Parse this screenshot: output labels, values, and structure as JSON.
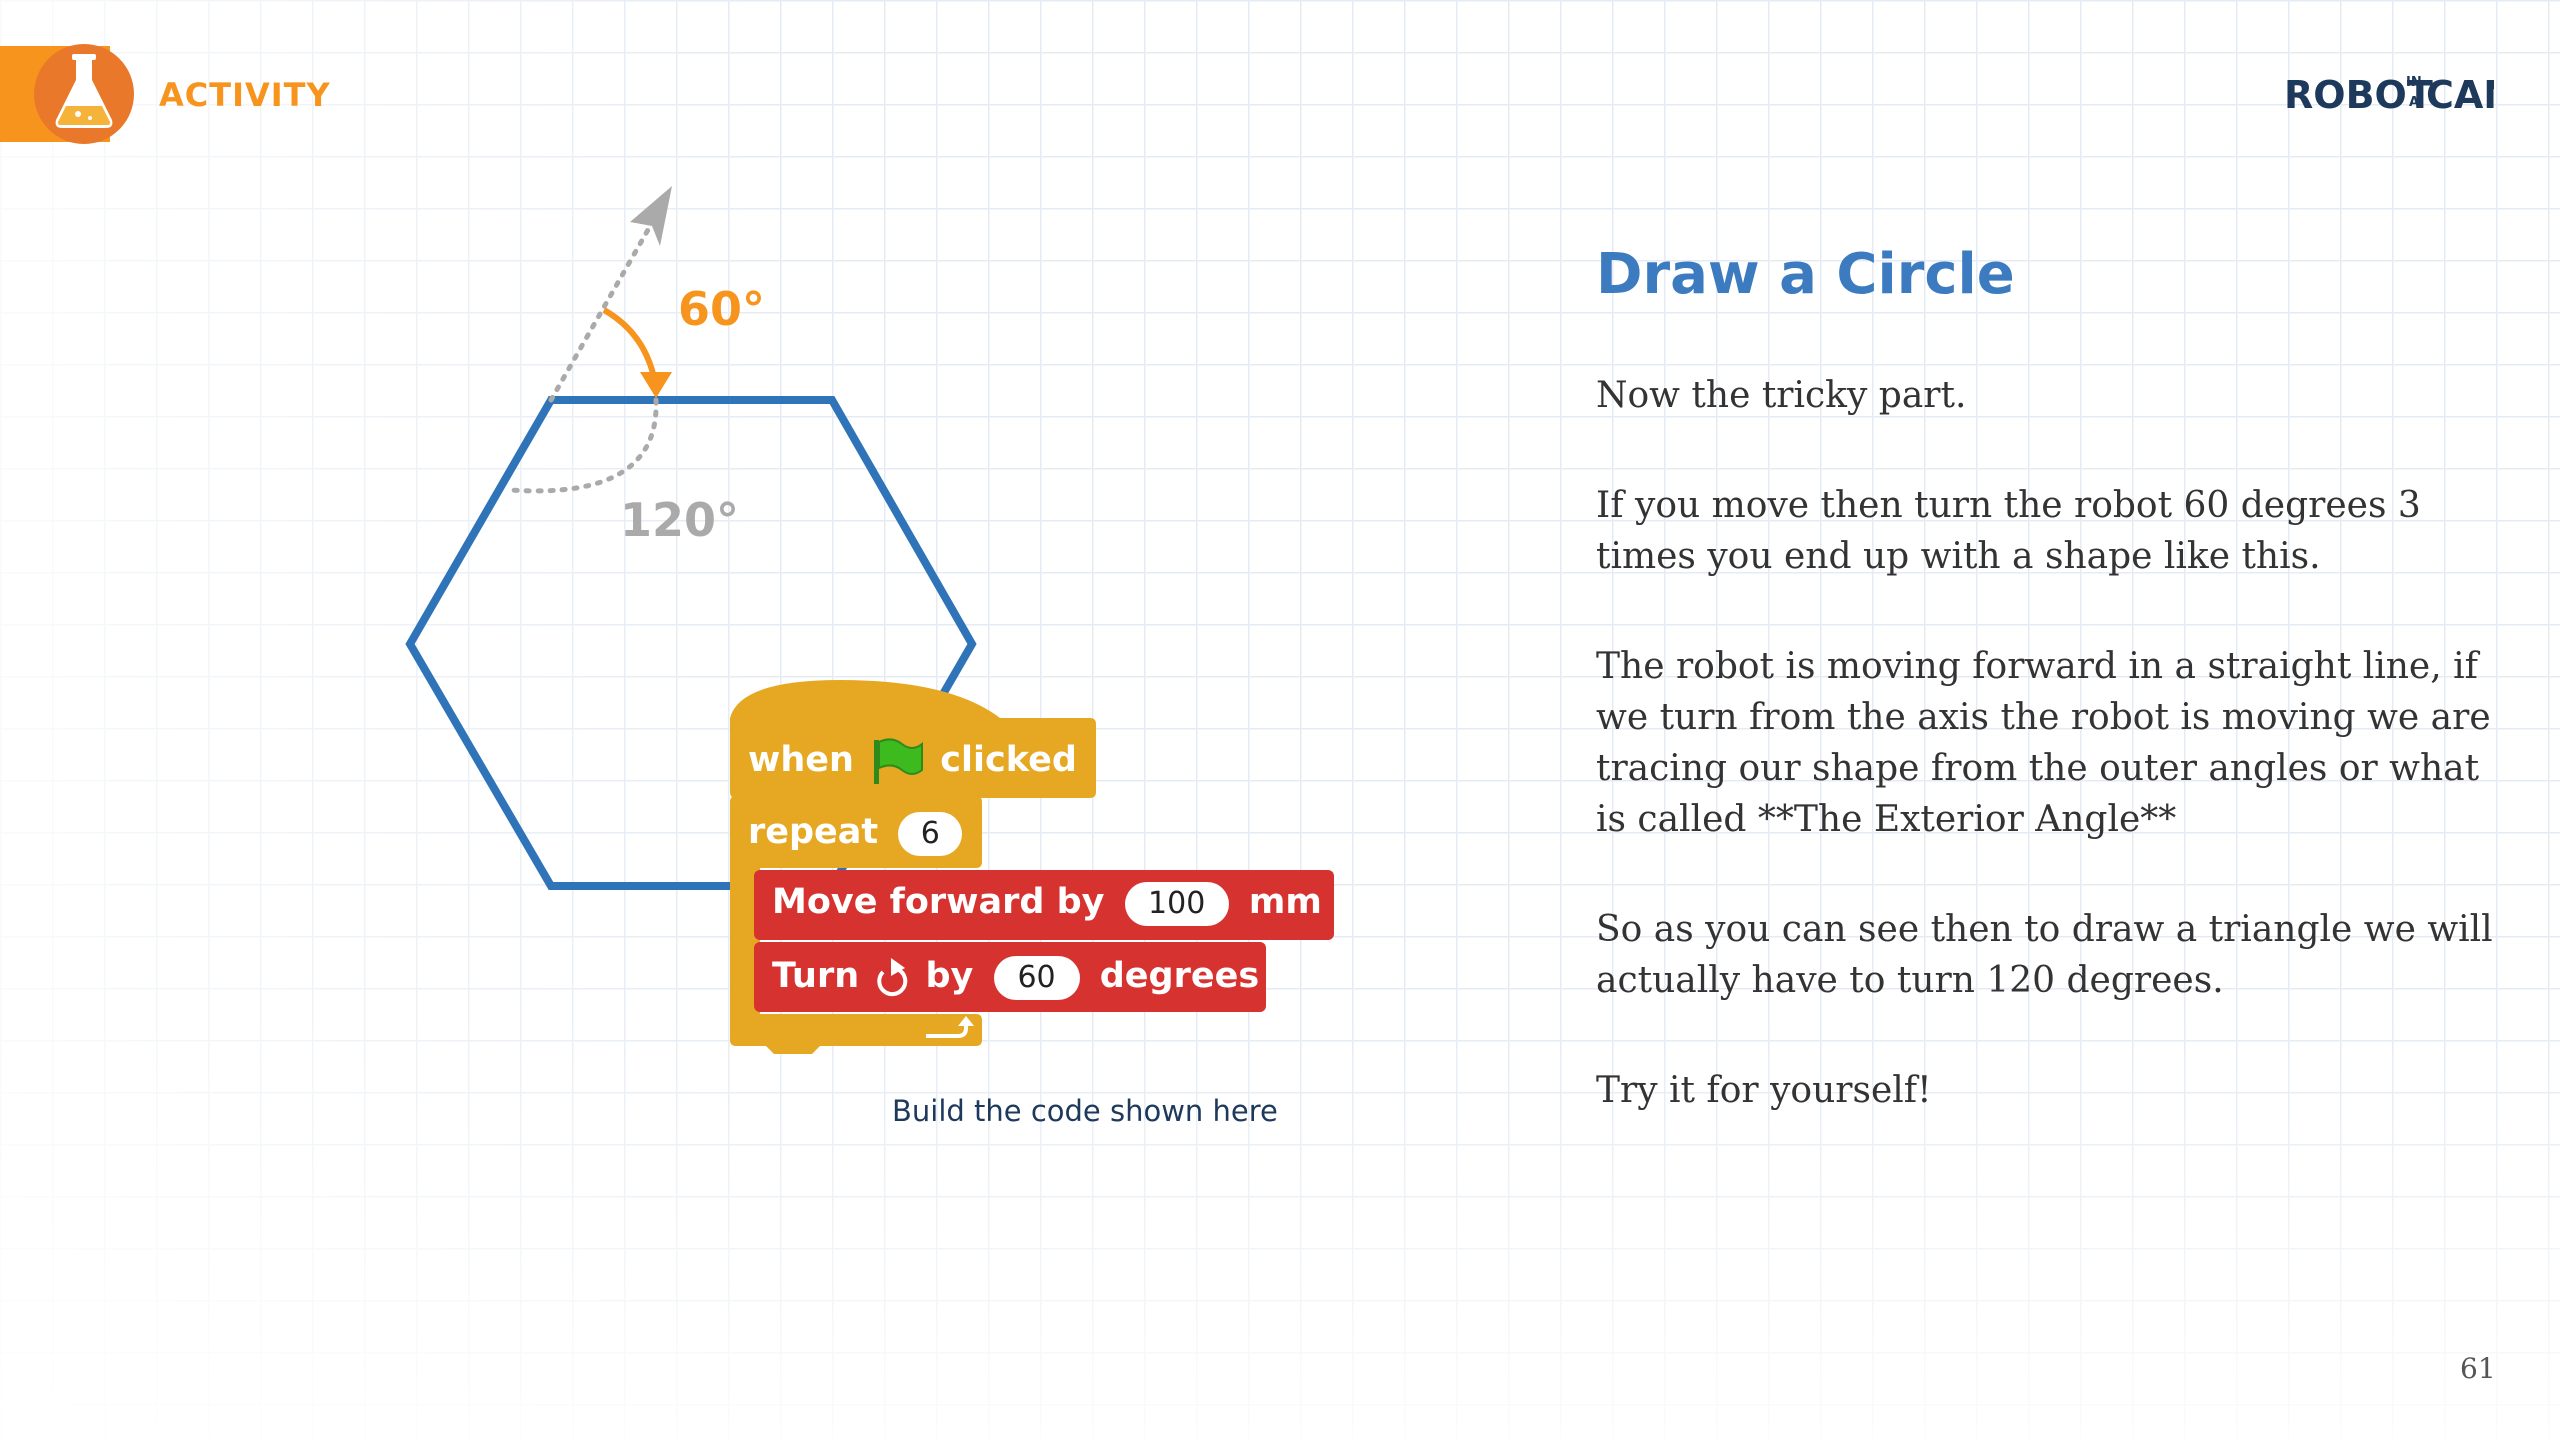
{
  "header": {
    "section_label": "ACTIVITY",
    "icon": "flask-icon",
    "logo": {
      "word_left": "ROBOT",
      "word_small_top": "IN",
      "word_small_bottom": "A",
      "word_right": "CAN"
    }
  },
  "colors": {
    "accent_orange": "#f7941d",
    "title_blue": "#3c7bbf",
    "hexagon_blue": "#2f74b8",
    "scratch_control": "#e6a822",
    "scratch_motion_red": "#d63330",
    "logo_navy": "#1d3a5c"
  },
  "diagram": {
    "exterior_angle_label": "60°",
    "interior_angle_label": "120°"
  },
  "code_blocks": {
    "hat": {
      "label_when": "when",
      "icon": "green-flag-icon",
      "label_clicked": "clicked"
    },
    "repeat": {
      "label": "repeat",
      "count": "6"
    },
    "move": {
      "label": "Move forward by",
      "value": "100",
      "unit": "mm"
    },
    "turn": {
      "label": "Turn",
      "icon": "turn-clockwise-icon",
      "by": "by",
      "value": "60",
      "unit": "degrees"
    },
    "loop_end_icon": "loop-arrow-icon"
  },
  "caption": "Build the code shown here",
  "content": {
    "title": "Draw a Circle",
    "paragraphs": [
      "Now the tricky part.",
      "If you move then turn the robot 60 degrees 3 times you end up with a shape like this.",
      "The robot is moving forward in a straight line, if we turn from the axis the robot is moving we are tracing our shape from the outer angles or what is called **The Exterior Angle**",
      "So as you can see then to draw a triangle we will actually have to turn 120 degrees.",
      "Try it for yourself!"
    ]
  },
  "page_number": "61"
}
